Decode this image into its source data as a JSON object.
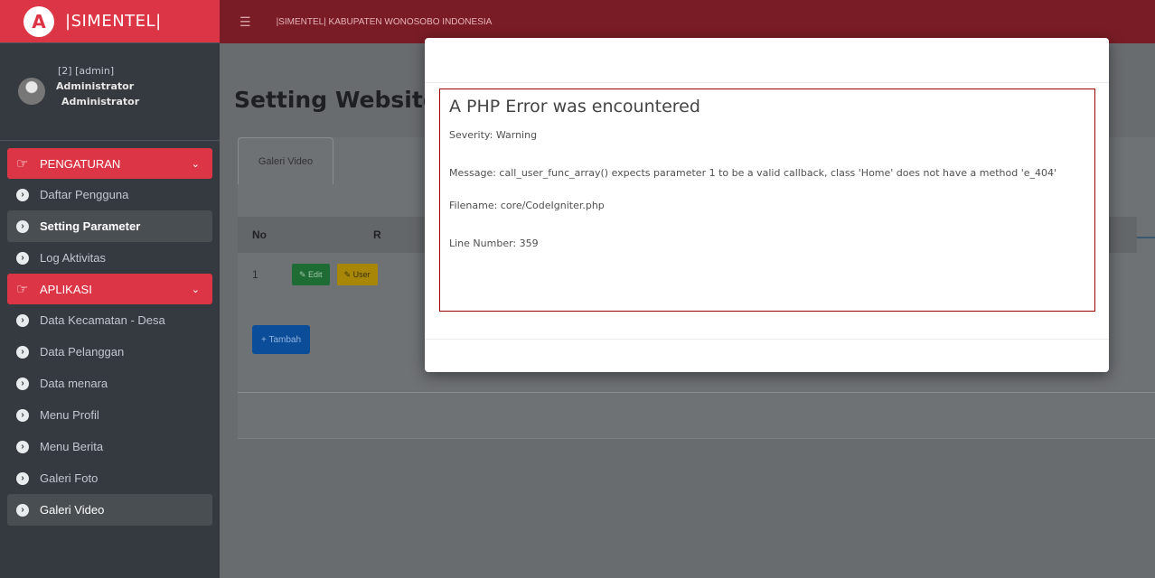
{
  "brand": {
    "logo_letter": "A",
    "name": "|SIMENTEL|"
  },
  "user": {
    "line1": "[2] [admin]",
    "line2": "Administrator",
    "line3": "Administrator"
  },
  "sidebar": {
    "pengaturan": {
      "label": "PENGATURAN",
      "items": [
        {
          "label": "Daftar Pengguna"
        },
        {
          "label": "Setting Parameter"
        },
        {
          "label": "Log Aktivitas"
        }
      ]
    },
    "aplikasi": {
      "label": "APLIKASI",
      "items": [
        {
          "label": "Data Kecamatan - Desa"
        },
        {
          "label": "Data Pelanggan"
        },
        {
          "label": "Data menara"
        },
        {
          "label": "Menu Profil"
        },
        {
          "label": "Menu Berita"
        },
        {
          "label": "Galeri Foto"
        },
        {
          "label": "Galeri Video"
        }
      ]
    }
  },
  "topbar": {
    "title": "|SIMENTEL| KABUPATEN WONOSOBO INDONESIA"
  },
  "page": {
    "title": "Setting Website",
    "tab": "Galeri Video",
    "table": {
      "col_no": "No",
      "col_r": "R",
      "row1_no": "1",
      "edit_label": "✎ Edit",
      "user_label": "✎ User"
    },
    "add_label": "+ Tambah"
  },
  "modal": {
    "title": "A PHP Error was encountered",
    "severity": "Severity: Warning",
    "message": "Message: call_user_func_array() expects parameter 1 to be a valid callback, class 'Home' does not have a method 'e_404'",
    "filename": "Filename: core/CodeIgniter.php",
    "line_number": "Line Number: 359"
  }
}
